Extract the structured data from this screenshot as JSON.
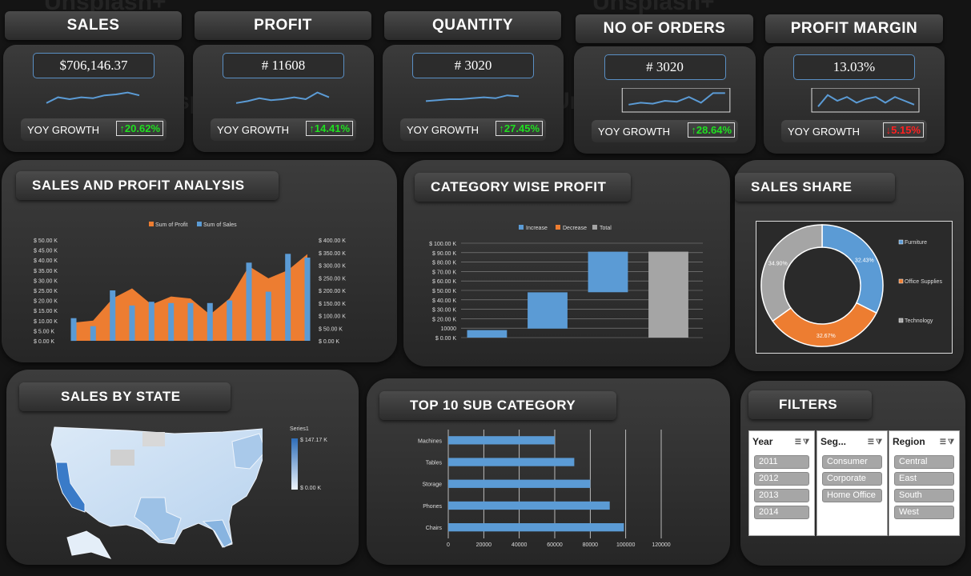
{
  "kpis": [
    {
      "title": "SALES",
      "value": "$706,146.37",
      "yoy_label": "YOY GROWTH",
      "yoy": "↑20.62%",
      "yoy_color": "#1fe01f"
    },
    {
      "title": "PROFIT",
      "value": "# 11608",
      "yoy_label": "YOY GROWTH",
      "yoy": "↑14.41%",
      "yoy_color": "#1fe01f"
    },
    {
      "title": "QUANTITY",
      "value": "# 3020",
      "yoy_label": "YOY GROWTH",
      "yoy": "↑27.45%",
      "yoy_color": "#1fe01f"
    },
    {
      "title": "NO OF ORDERS",
      "value": "# 3020",
      "yoy_label": "YOY GROWTH",
      "yoy": "↑28.64%",
      "yoy_color": "#1fe01f"
    },
    {
      "title": "PROFIT MARGIN",
      "value": "13.03%",
      "yoy_label": "YOY GROWTH",
      "yoy": "↓5.15%",
      "yoy_color": "#ff2020"
    }
  ],
  "panels": {
    "sales_profit": "SALES AND PROFIT ANALYSIS",
    "category_profit": "CATEGORY WISE PROFIT",
    "sales_share": "SALES SHARE",
    "sales_by_state": "SALES BY STATE",
    "top10": "TOP 10 SUB CATEGORY",
    "filters": "FILTERS"
  },
  "watermark": "Unsplash+",
  "chart_data": [
    {
      "type": "bar",
      "name": "sales-profit-combo",
      "legend": [
        "Sum of Profit",
        "Sum of Sales"
      ],
      "colors": {
        "profit": "#ed7d31",
        "sales": "#5b9bd5"
      },
      "left_ticks": [
        "$ 50.00 K",
        "$ 45.00 K",
        "$ 40.00 K",
        "$ 35.00 K",
        "$ 30.00 K",
        "$ 25.00 K",
        "$ 20.00 K",
        "$ 15.00 K",
        "$ 10.00 K",
        "$ 5.00 K",
        "$ 0.00 K"
      ],
      "right_ticks": [
        "$ 400.00 K",
        "$ 350.00 K",
        "$ 300.00 K",
        "$ 250.00 K",
        "$ 200.00 K",
        "$ 150.00 K",
        "$ 100.00 K",
        "$ 50.00 K",
        "$ 0.00 K"
      ],
      "ylim_profit": [
        0,
        50000
      ],
      "ylim_sales": [
        0,
        400000
      ],
      "profit": [
        9000,
        10000,
        21000,
        26000,
        18000,
        22000,
        21000,
        13000,
        21000,
        37000,
        31000,
        35000,
        43000
      ],
      "sales": [
        90000,
        58000,
        200000,
        140000,
        155000,
        150000,
        150000,
        150000,
        160000,
        310000,
        195000,
        345000,
        330000
      ]
    },
    {
      "type": "bar",
      "name": "category-waterfall",
      "legend": [
        "Increase",
        "Decrease",
        "Total"
      ],
      "colors": {
        "increase": "#5b9bd5",
        "decrease": "#ed7d31",
        "total": "#a5a5a5"
      },
      "y_ticks": [
        "$ 100.00 K",
        "$ 90.00 K",
        "$ 80.00 K",
        "$ 70.00 K",
        "$ 60.00 K",
        "$ 50.00 K",
        "$ 40.00 K",
        "$ 30.00 K",
        "$ 20.00 K",
        "10000",
        "$ 0.00 K"
      ],
      "ylim": [
        0,
        100000
      ],
      "steps": [
        {
          "kind": "increase",
          "start": 0,
          "end": 8000
        },
        {
          "kind": "increase",
          "start": 9500,
          "end": 48000
        },
        {
          "kind": "increase",
          "start": 48000,
          "end": 91000
        },
        {
          "kind": "total",
          "start": 0,
          "end": 91000
        }
      ]
    },
    {
      "type": "pie",
      "name": "sales-share-donut",
      "labels": [
        "Furniture",
        "Office Supplies",
        "Technology"
      ],
      "values": [
        32.43,
        32.67,
        34.9
      ],
      "display": [
        "32.43%",
        "32.67%",
        "34.90%"
      ],
      "colors": [
        "#5b9bd5",
        "#ed7d31",
        "#a5a5a5"
      ]
    },
    {
      "type": "bar",
      "name": "top10-subcategory",
      "categories": [
        "Machines",
        "Tables",
        "Storage",
        "Phones",
        "Chairs"
      ],
      "values": [
        60000,
        71000,
        80000,
        91000,
        99000
      ],
      "x_ticks": [
        "0",
        "20000",
        "40000",
        "60000",
        "80000",
        "100000",
        "120000"
      ],
      "xlim": [
        0,
        120000
      ],
      "color": "#5b9bd5"
    }
  ],
  "map": {
    "legend_title": "Series1",
    "max_label": "$ 147.17 K",
    "min_label": "$ 0.00 K"
  },
  "slicers": [
    {
      "title": "Year",
      "items": [
        "2011",
        "2012",
        "2013",
        "2014"
      ]
    },
    {
      "title": "Seg...",
      "items": [
        "Consumer",
        "Corporate",
        "Home Office"
      ]
    },
    {
      "title": "Region",
      "items": [
        "Central",
        "East",
        "South",
        "West"
      ]
    }
  ]
}
